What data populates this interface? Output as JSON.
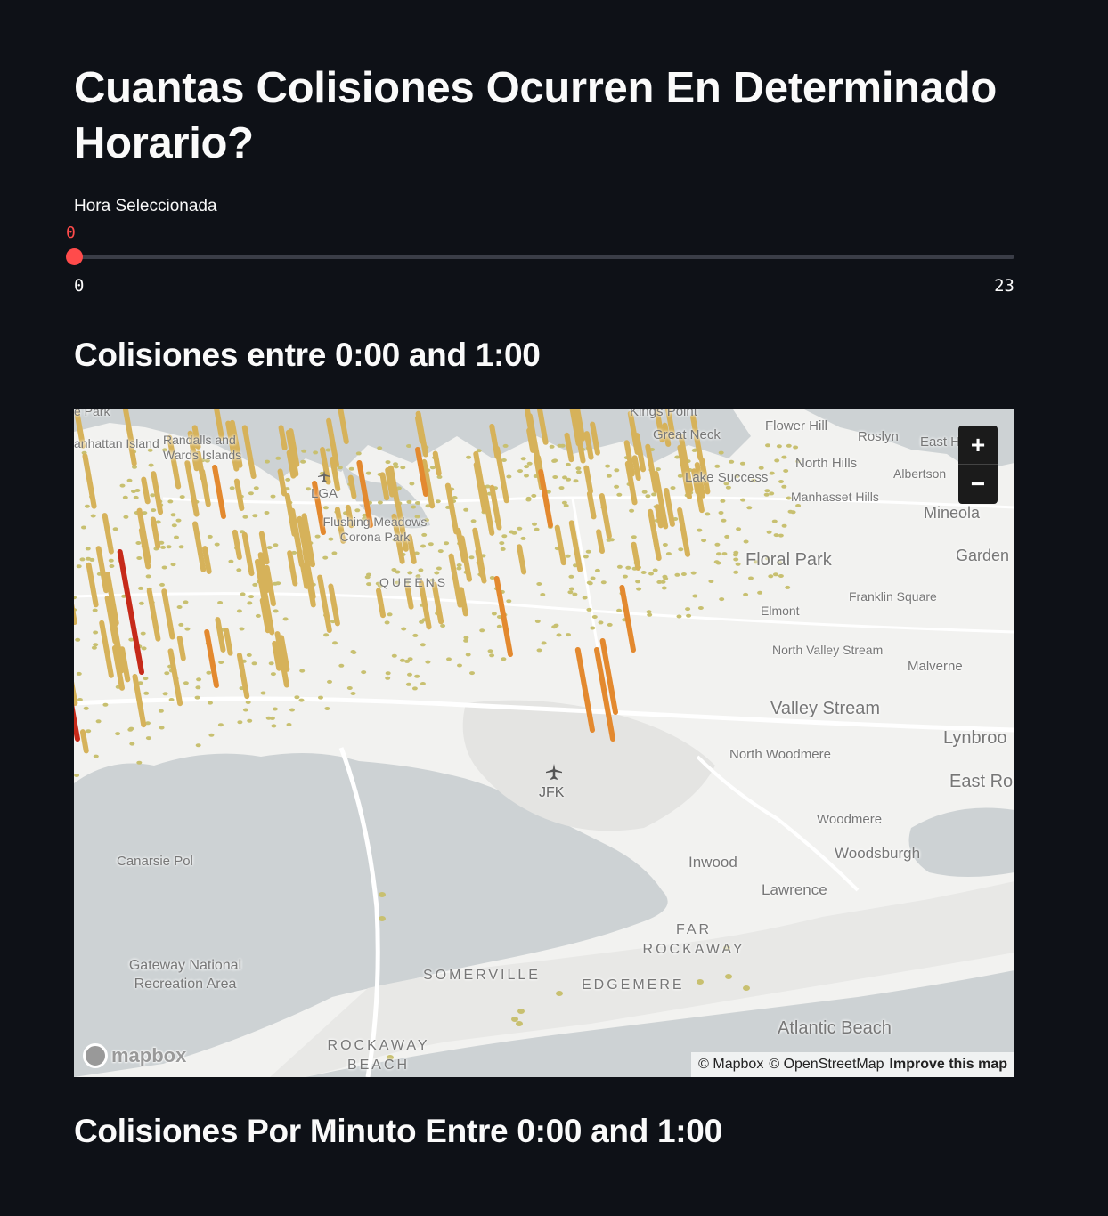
{
  "page": {
    "title": "Cuantas Colisiones Ocurren En Determinado Horario?",
    "map_heading": "Colisiones entre 0:00 and 1:00",
    "minute_heading": "Colisiones Por Minuto Entre 0:00 and 1:00"
  },
  "slider": {
    "label": "Hora Seleccionada",
    "value": "0",
    "min_label": "0",
    "max_label": "23",
    "min": 0,
    "max": 23,
    "current": 0
  },
  "map": {
    "zoom_in": "+",
    "zoom_out": "−",
    "attribution": [
      "© Mapbox",
      "© OpenStreetMap"
    ],
    "improve": "Improve this map",
    "logo": "mapbox",
    "colors": {
      "land": "#f2f2f0",
      "water": "#cdd2d4",
      "bar_light": "#d6b25a",
      "bar_mid": "#e3892f",
      "bar_hot": "#c62a1a",
      "dot": "#c8c070"
    },
    "places": [
      "Kings Point",
      "Great Neck",
      "Flower Hill",
      "Roslyn",
      "East H",
      "Randalls and Wards Islands",
      "anhattan Island",
      "e Park",
      "North Hills",
      "Albertson",
      "Lake Success",
      "LGA",
      "Manhasset Hills",
      "Mineola",
      "Flushing Meadows Corona Park",
      "Floral Park",
      "Garden",
      "QUEENS",
      "Franklin Square",
      "Elmont",
      "North Valley Stream",
      "Malverne",
      "Valley Stream",
      "Lynbroo",
      "North Woodmere",
      "JFK",
      "East Ro",
      "Woodmere",
      "Canarsie Pol",
      "Woodsburgh",
      "Inwood",
      "Lawrence",
      "FAR ROCKAWAY",
      "Gateway National Recreation Area",
      "SOMERVILLE",
      "EDGEMERE",
      "Atlantic Beach",
      "ROCKAWAY BEACH"
    ]
  }
}
